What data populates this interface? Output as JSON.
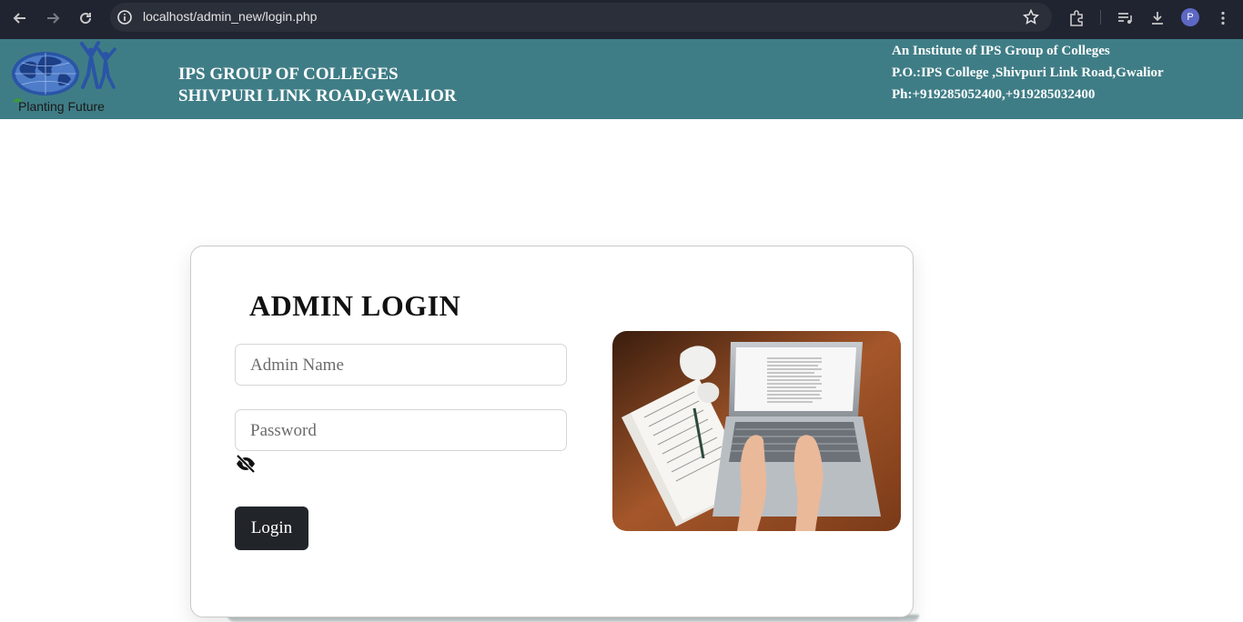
{
  "browser": {
    "url": "localhost/admin_new/login.php",
    "profile_initial": "P",
    "icons": [
      "back-icon",
      "forward-icon",
      "reload-icon",
      "info-icon",
      "star-icon",
      "extensions-icon",
      "media-icon",
      "download-icon",
      "menu-icon"
    ]
  },
  "header": {
    "background_color": "#3f7d86",
    "logo_tagline": "Planting Future",
    "college_name_line1": "IPS GROUP OF COLLEGES",
    "college_name_line2": "SHIVPURI LINK ROAD,GWALIOR",
    "info_line1": "An Institute of IPS Group of Colleges",
    "info_line2": "P.O.:IPS College ,Shivpuri Link Road,Gwalior",
    "info_line3": "Ph:+919285052400,+919285032400"
  },
  "login": {
    "title": "ADMIN LOGIN",
    "username_placeholder": "Admin Name",
    "password_placeholder": "Password",
    "toggle_icon": "eye-slash-icon",
    "button_label": "Login",
    "button_color": "#212529"
  }
}
